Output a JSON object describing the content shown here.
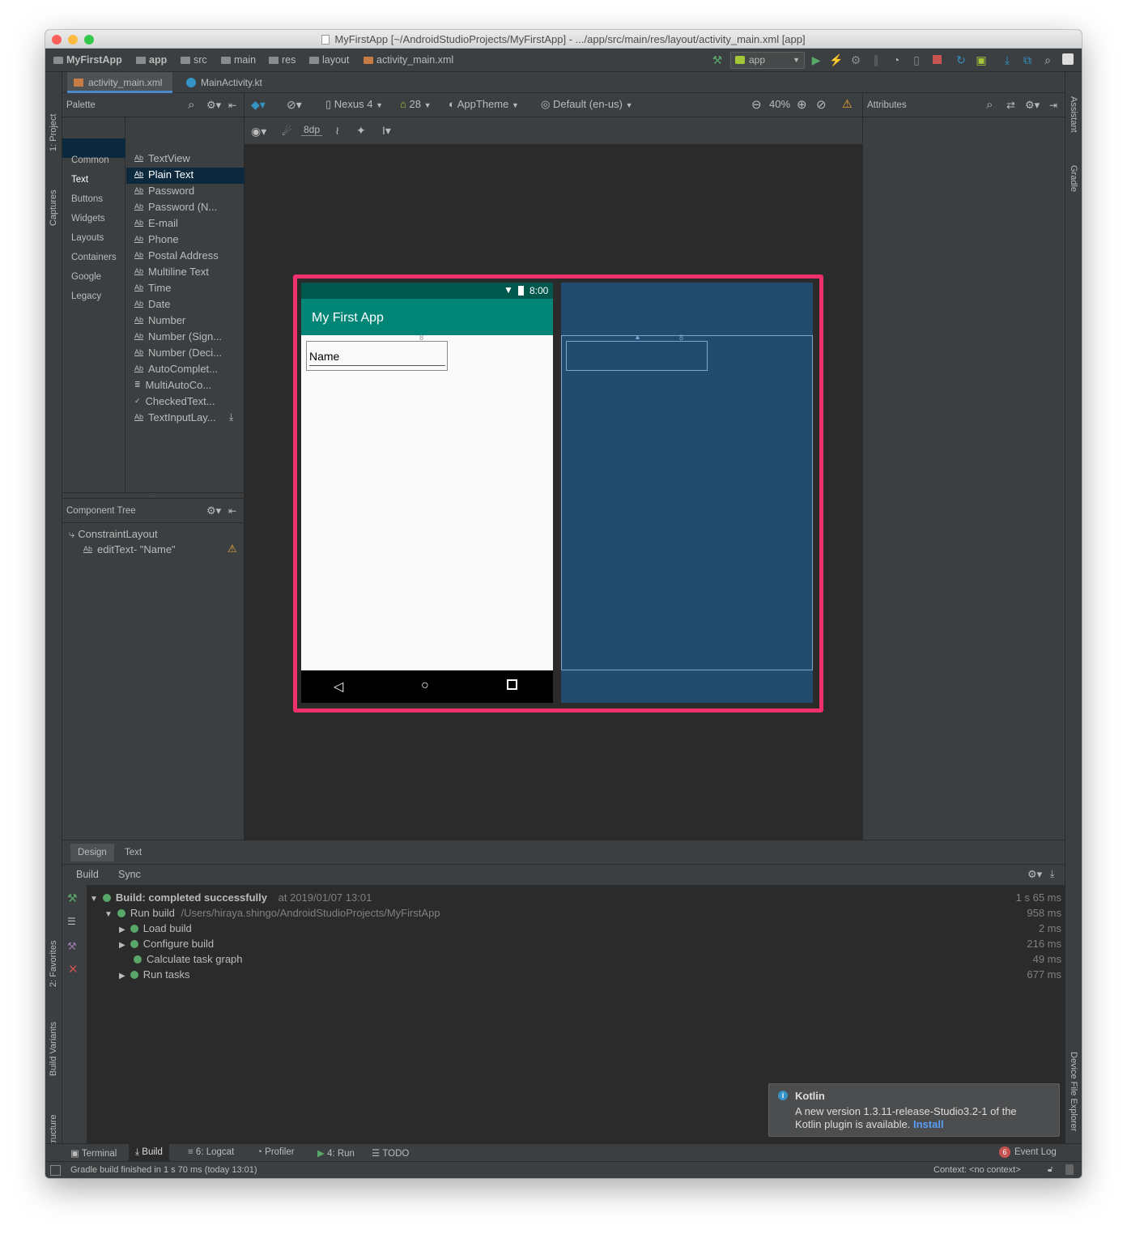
{
  "window": {
    "title": "MyFirstApp [~/AndroidStudioProjects/MyFirstApp] - .../app/src/main/res/layout/activity_main.xml [app]"
  },
  "breadcrumb": [
    "MyFirstApp",
    "app",
    "src",
    "main",
    "res",
    "layout",
    "activity_main.xml"
  ],
  "run_config": "app",
  "editor_tabs": [
    {
      "label": "activity_main.xml",
      "active": true
    },
    {
      "label": "MainActivity.kt",
      "active": false
    }
  ],
  "left_strip": [
    "1: Project",
    "Captures",
    "2: Favorites",
    "Build Variants",
    "Z: Structure"
  ],
  "right_strip": [
    "Assistant",
    "Gradle",
    "Device File Explorer"
  ],
  "palette": {
    "title": "Palette",
    "categories": [
      "Common",
      "Text",
      "Buttons",
      "Widgets",
      "Layouts",
      "Containers",
      "Google",
      "Legacy"
    ],
    "selected_category": "Text",
    "items": [
      "TextView",
      "Plain Text",
      "Password",
      "Password (N...",
      "E-mail",
      "Phone",
      "Postal Address",
      "Multiline Text",
      "Time",
      "Date",
      "Number",
      "Number (Sign...",
      "Number (Deci...",
      "AutoComplet...",
      "MultiAutoCo...",
      "CheckedText...",
      "TextInputLay..."
    ],
    "selected_item": "Plain Text"
  },
  "component_tree": {
    "title": "Component Tree",
    "root": "ConstraintLayout",
    "child": "editText- \"Name\""
  },
  "design_toolbar": {
    "device": "Nexus 4",
    "api": "28",
    "theme": "AppTheme",
    "locale": "Default (en-us)",
    "zoom": "40%",
    "margin": "8dp"
  },
  "attributes": {
    "title": "Attributes"
  },
  "phone": {
    "time": "8:00",
    "app_title": "My First App",
    "edittext_hint": "Name",
    "margin_marker": "8",
    "colors": {
      "status": "#00574b",
      "toolbar": "#008577",
      "highlight": "#f0306c",
      "blueprint": "#234b6e"
    }
  },
  "bottom_tabs": [
    "Design",
    "Text"
  ],
  "build": {
    "tabs": [
      "Build",
      "Sync"
    ],
    "rows": [
      {
        "label": "Build: completed successfully",
        "extra": "at 2019/01/07 13:01",
        "time": "1 s 65 ms"
      },
      {
        "label": "Run build",
        "extra": "/Users/hiraya.shingo/AndroidStudioProjects/MyFirstApp",
        "time": "958 ms"
      },
      {
        "label": "Load build",
        "extra": "",
        "time": "2 ms"
      },
      {
        "label": "Configure build",
        "extra": "",
        "time": "216 ms"
      },
      {
        "label": "Calculate task graph",
        "extra": "",
        "time": "49 ms"
      },
      {
        "label": "Run tasks",
        "extra": "",
        "time": "677 ms"
      }
    ]
  },
  "notification": {
    "title": "Kotlin",
    "message": "A new version 1.3.11-release-Studio3.2-1 of the Kotlin plugin is available.",
    "action": "Install"
  },
  "tool_windows": [
    "Terminal",
    "Build",
    "6: Logcat",
    "Profiler",
    "4: Run",
    "TODO"
  ],
  "event_log": {
    "label": "Event Log",
    "count": "6"
  },
  "status_bar": {
    "message": "Gradle build finished in 1 s 70 ms (today 13:01)",
    "context": "Context: <no context>"
  }
}
